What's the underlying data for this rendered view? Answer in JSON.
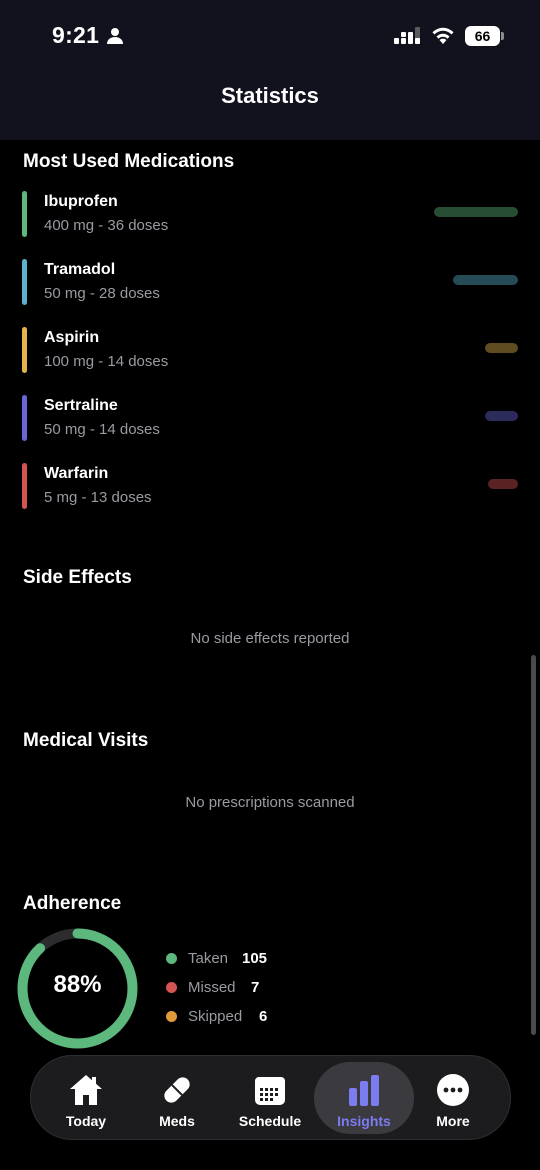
{
  "status_bar": {
    "time": "9:21",
    "battery": "66"
  },
  "header": {
    "title": "Statistics"
  },
  "most_used": {
    "title": "Most Used Medications",
    "items": [
      {
        "name": "Ibuprofen",
        "detail": "400 mg - 36 doses",
        "color": "#5cb87c",
        "doses": 36
      },
      {
        "name": "Tramadol",
        "detail": "50 mg - 28 doses",
        "color": "#5bb2cc",
        "doses": 28
      },
      {
        "name": "Aspirin",
        "detail": "100 mg - 14 doses",
        "color": "#e3b44c",
        "doses": 14
      },
      {
        "name": "Sertraline",
        "detail": "50 mg - 14 doses",
        "color": "#6a66d8",
        "doses": 14
      },
      {
        "name": "Warfarin",
        "detail": "5 mg - 13 doses",
        "color": "#d45454",
        "doses": 13
      }
    ]
  },
  "side_effects": {
    "title": "Side Effects",
    "empty": "No side effects reported"
  },
  "medical_visits": {
    "title": "Medical Visits",
    "empty": "No prescriptions scanned"
  },
  "adherence": {
    "title": "Adherence",
    "percent_label": "88%",
    "percent": 88,
    "ring_color": "#5cb87c",
    "legend": [
      {
        "label": "Taken",
        "value": "105",
        "color": "#5cb87c"
      },
      {
        "label": "Missed",
        "value": "7",
        "color": "#d45454"
      },
      {
        "label": "Skipped",
        "value": "6",
        "color": "#e09a3a"
      }
    ]
  },
  "tabbar": {
    "tabs": [
      {
        "label": "Today",
        "icon": "house-icon"
      },
      {
        "label": "Meds",
        "icon": "pill-icon"
      },
      {
        "label": "Schedule",
        "icon": "calendar-icon"
      },
      {
        "label": "Insights",
        "icon": "bar-chart-icon",
        "active": true
      },
      {
        "label": "More",
        "icon": "more-icon"
      }
    ],
    "active_color": "#7b7cf0"
  }
}
